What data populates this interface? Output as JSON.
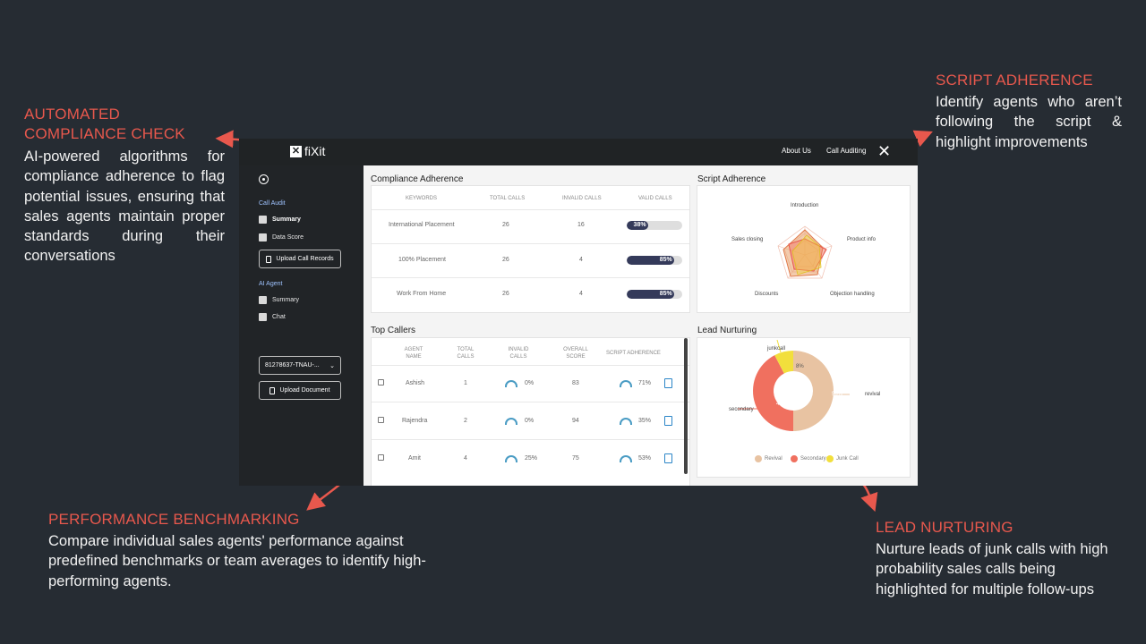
{
  "callouts": {
    "compliance": {
      "title_1": "AUTOMATED",
      "title_2": "COMPLIANCE CHECK",
      "body": "AI-powered algorithms for compliance adherence to flag potential issues, ensuring that sales agents maintain proper standards during their conversations"
    },
    "script": {
      "title": "SCRIPT ADHERENCE",
      "body": "Identify agents who aren’t following the script & highlight improvements"
    },
    "performance": {
      "title": "PERFORMANCE BENCHMARKING",
      "body": "Compare individual sales agents' performance against predefined benchmarks or team averages to identify high-performing agents."
    },
    "lead": {
      "title": "LEAD NURTURING",
      "body": "Nurture leads of junk calls with high probability sales calls being highlighted for multiple follow-ups"
    }
  },
  "app": {
    "logo_text": "fiXit",
    "logo_mark": "✕",
    "nav": {
      "about": "About Us",
      "audit": "Call Auditing",
      "close": "✕"
    },
    "sidebar": {
      "section_audit": "Call Audit",
      "audit_items": [
        "Summary",
        "Data Score"
      ],
      "upload_calls": "Upload Call Records",
      "section_agent": "AI Agent",
      "agent_items": [
        "Summary",
        "Chat"
      ],
      "select_value": "81278637-TNAU-...",
      "select_chevron": "⌄",
      "upload_doc": "Upload Document"
    },
    "compliance": {
      "title": "Compliance Adherence",
      "headers": [
        "KEYWORDS",
        "TOTAL CALLS",
        "INVALID CALLS",
        "VALID CALLS"
      ],
      "rows": [
        {
          "keyword": "International Placement",
          "total": "26",
          "invalid": "16",
          "valid_label": "38%",
          "valid": 0.38
        },
        {
          "keyword": "100% Placement",
          "total": "26",
          "invalid": "4",
          "valid_label": "85%",
          "valid": 0.85
        },
        {
          "keyword": "Work From Home",
          "total": "26",
          "invalid": "4",
          "valid_label": "85%",
          "valid": 0.85
        }
      ]
    },
    "script": {
      "title": "Script Adherence",
      "axes": [
        "Introduction",
        "Product info",
        "Objection handling",
        "Discounts",
        "Sales closing"
      ]
    },
    "callers": {
      "title": "Top Callers",
      "headers": {
        "agent_1": "AGENT",
        "agent_2": "NAME",
        "total_1": "TOTAL",
        "total_2": "CALLS",
        "invalid_1": "INVALID",
        "invalid_2": "CALLS",
        "overall_1": "OVERALL",
        "overall_2": "SCORE",
        "script": "SCRIPT ADHERENCE"
      },
      "rows": [
        {
          "name": "Ashish",
          "total": "1",
          "invalid": "0%",
          "score": "83",
          "script": "71%"
        },
        {
          "name": "Rajendra",
          "total": "2",
          "invalid": "0%",
          "score": "94",
          "script": "35%"
        },
        {
          "name": "Amit",
          "total": "4",
          "invalid": "25%",
          "score": "75",
          "script": "53%"
        }
      ]
    },
    "lead": {
      "title": "Lead Nurturing",
      "labels": {
        "junkcall": "junkcall",
        "revival": "revival",
        "secondary": "secondary"
      },
      "slice_labels": {
        "revival": "50%",
        "secondary": "42%",
        "junk": "8%"
      },
      "legend": [
        "Revival",
        "Secondary",
        "Junk Call"
      ],
      "colors": {
        "revival": "#e8c3a2",
        "secondary": "#f0705f",
        "junk": "#f2df3c"
      }
    }
  }
}
